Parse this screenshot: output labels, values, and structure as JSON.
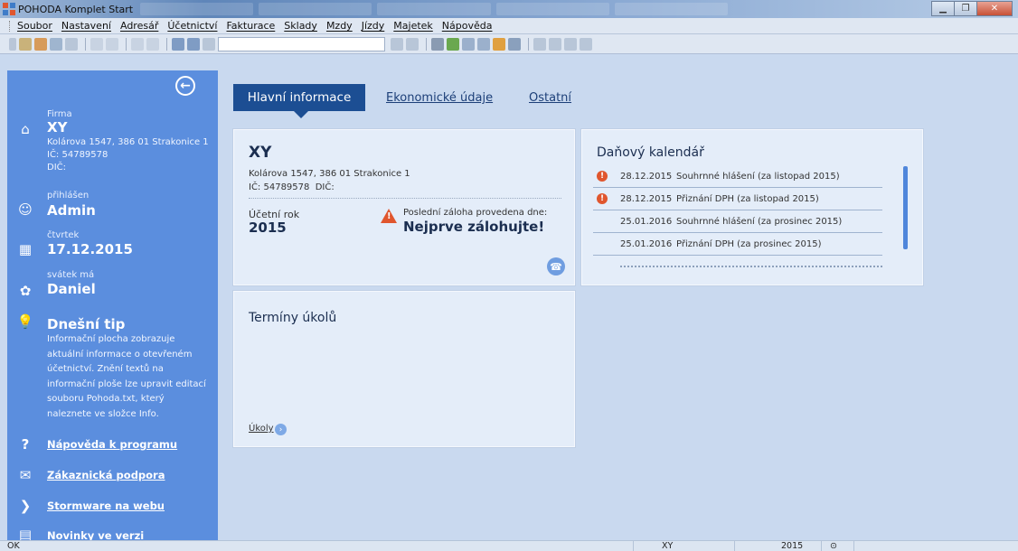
{
  "window": {
    "title": "POHODA Komplet Start"
  },
  "menu": [
    "Soubor",
    "Nastavení",
    "Adresář",
    "Účetnictví",
    "Fakturace",
    "Sklady",
    "Mzdy",
    "Jízdy",
    "Majetek",
    "Nápověda"
  ],
  "sidebar": {
    "firma_label": "Firma",
    "firma_name": "XY",
    "firma_address": "Kolárova 1547, 386 01 Strakonice 1",
    "firma_ic": "IČ: 54789578",
    "firma_dic": "DIČ:",
    "user_label": "přihlášen",
    "user_name": "Admin",
    "day_label": "čtvrtek",
    "date": "17.12.2015",
    "nameday_label": "svátek má",
    "nameday_name": "Daniel",
    "tip_title": "Dnešní tip",
    "tip_text": "Informační plocha zobrazuje aktuální informace o otevřeném účetnictví. Znění textů na informační ploše lze upravit editací souboru Pohoda.txt, který naleznete ve složce Info.",
    "links": [
      "Nápověda k programu",
      "Zákaznická podpora",
      "Stormware na webu",
      "Novinky ve verzi"
    ]
  },
  "tabs": {
    "active": "Hlavní informace",
    "economic": "Ekonomické údaje",
    "other": "Ostatní"
  },
  "company_panel": {
    "name": "XY",
    "address": "Kolárova 1547, 386 01 Strakonice 1",
    "ids": "IČ: 54789578  DIČ:",
    "year_label": "Účetní rok",
    "year": "2015",
    "backup_label": "Poslední záloha provedena dne:",
    "backup_value": "Nejprve zálohujte!"
  },
  "tax_calendar": {
    "title": "Daňový kalendář",
    "rows": [
      {
        "alert": true,
        "date": "28.12.2015",
        "desc": "Souhrnné hlášení (za listopad 2015)"
      },
      {
        "alert": true,
        "date": "28.12.2015",
        "desc": "Přiznání DPH (za listopad 2015)"
      },
      {
        "alert": false,
        "date": "25.01.2016",
        "desc": "Souhrnné hlášení (za prosinec 2015)"
      },
      {
        "alert": false,
        "date": "25.01.2016",
        "desc": "Přiznání DPH (za prosinec 2015)"
      }
    ]
  },
  "tasks_panel": {
    "title": "Termíny úkolů",
    "link": "Úkoly"
  },
  "status": {
    "left": "OK",
    "company": "XY",
    "year": "2015"
  }
}
